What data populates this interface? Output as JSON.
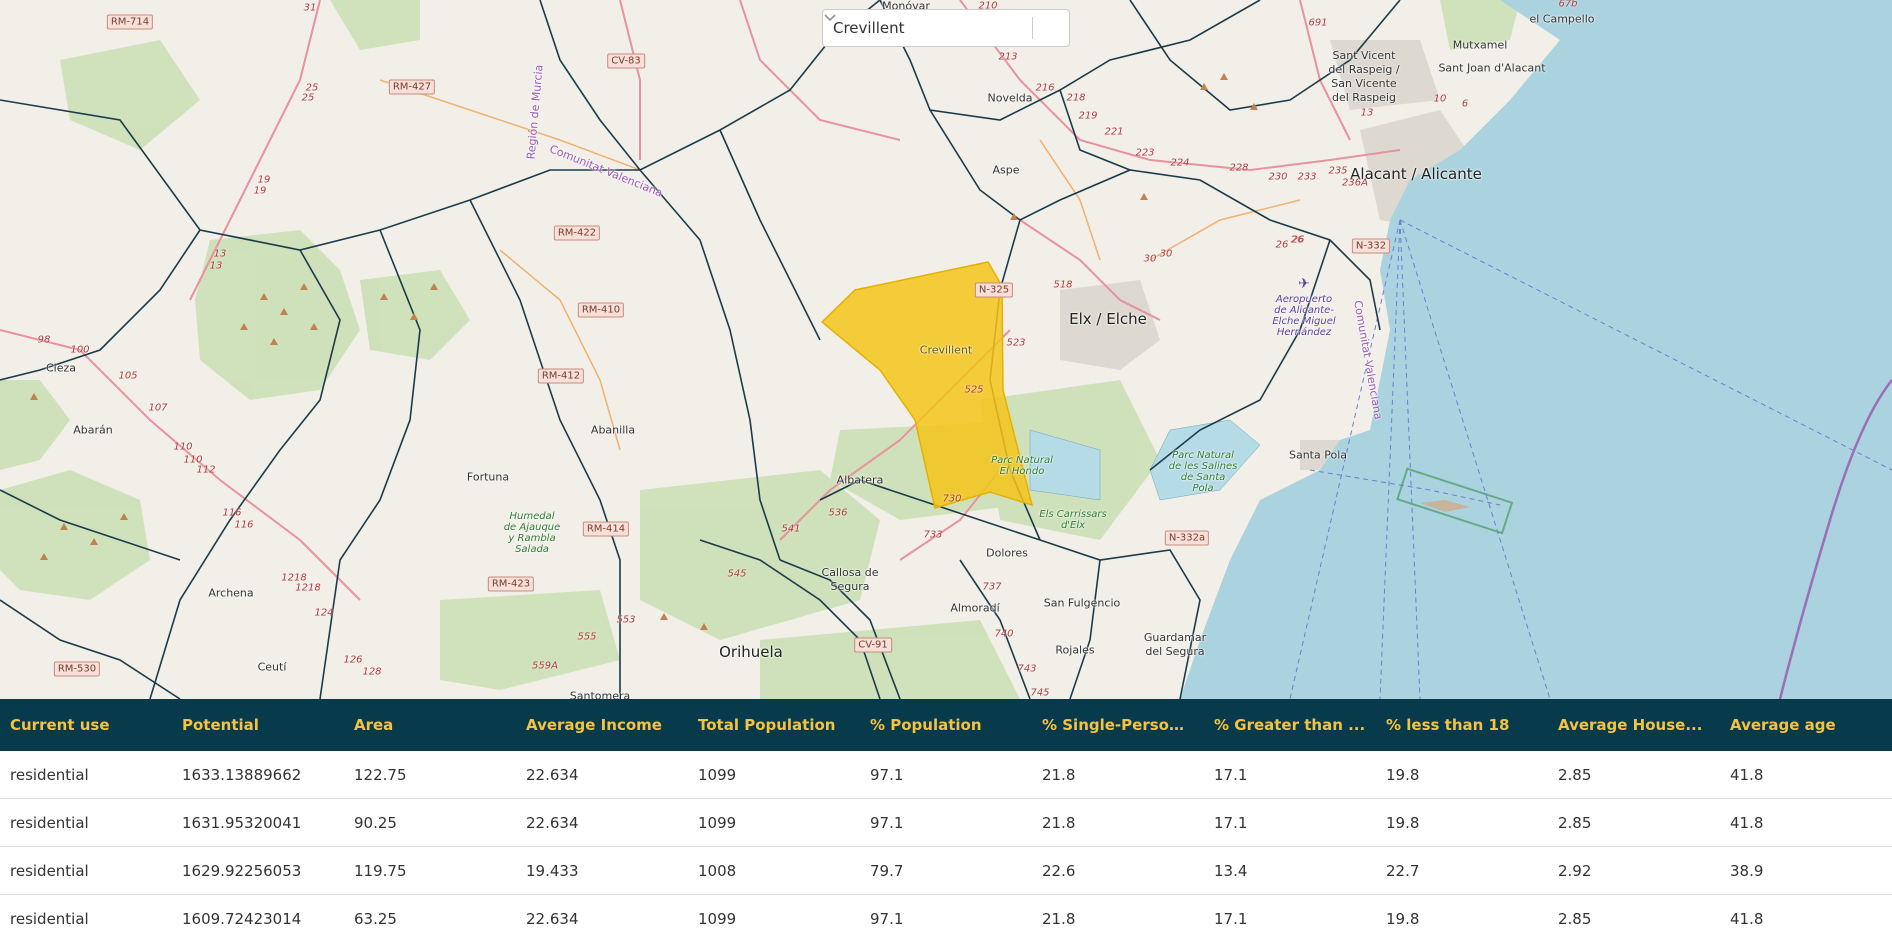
{
  "search": {
    "selected": "Crevillent"
  },
  "map": {
    "places": [
      {
        "label": "Monóvar",
        "cls": "small"
      },
      {
        "label": "Novelda",
        "cls": "small"
      },
      {
        "label": "Aspe",
        "cls": "small"
      },
      {
        "label": "Elx / Elche",
        "cls": "city"
      },
      {
        "label": "Crevillent",
        "cls": "small"
      },
      {
        "label": "Albatera",
        "cls": "small"
      },
      {
        "label": "Callosa de\nSegura",
        "cls": "small"
      },
      {
        "label": "Dolores",
        "cls": "small"
      },
      {
        "label": "Almoradí",
        "cls": "small"
      },
      {
        "label": "Orihuela",
        "cls": "city"
      },
      {
        "label": "San Fulgencio",
        "cls": "small"
      },
      {
        "label": "Rojales",
        "cls": "small"
      },
      {
        "label": "Guardamar\ndel Segura",
        "cls": "small"
      },
      {
        "label": "Santa Pola",
        "cls": "small"
      },
      {
        "label": "Alacant / Alicante",
        "cls": "city"
      },
      {
        "label": "Sant Vicent\ndel Raspeig /\nSan Vicente\ndel Raspeig",
        "cls": "small"
      },
      {
        "label": "Mutxamel",
        "cls": "small"
      },
      {
        "label": "Sant Joan d'Alacant",
        "cls": "small"
      },
      {
        "label": "el Campello",
        "cls": "small"
      },
      {
        "label": "Abanilla",
        "cls": "small"
      },
      {
        "label": "Fortuna",
        "cls": "small"
      },
      {
        "label": "Abarán",
        "cls": "small"
      },
      {
        "label": "Cieza",
        "cls": "small"
      },
      {
        "label": "Archena",
        "cls": "small"
      },
      {
        "label": "Ceutí",
        "cls": "small"
      },
      {
        "label": "Santomera",
        "cls": "small"
      },
      {
        "label": "Humedal\nde Ajauque\ny Rambla\nSalada",
        "cls": "park"
      },
      {
        "label": "Parc Natural\nde les Salines\nde Santa\nPola",
        "cls": "park"
      },
      {
        "label": "Els Carrissars\nd'Elx",
        "cls": "park"
      },
      {
        "label": "Parc Natural\nEl Hondo",
        "cls": "park"
      },
      {
        "label": "Aeropuerto\nde Alicante-\nElche Miguel\nHernández",
        "cls": "airport"
      },
      {
        "label": "Comunitat Valenciana",
        "cls": "border"
      },
      {
        "label": "Región de Murcia",
        "cls": "border"
      },
      {
        "label": "Comunitat Valenciana",
        "cls": "border"
      }
    ],
    "shields": [
      "RM-714",
      "CV-83",
      "RM-427",
      "RM-422",
      "RM-410",
      "RM-412",
      "RM-414",
      "RM-423",
      "RM-530",
      "CV-91",
      "N-325",
      "N-332",
      "N-332a"
    ],
    "road_numbers": [
      "31",
      "25",
      "25",
      "19",
      "19",
      "13",
      "13",
      "98",
      "100",
      "105",
      "107",
      "110",
      "110",
      "112",
      "116",
      "116",
      "1218",
      "1218",
      "124",
      "126",
      "128",
      "555",
      "553",
      "559A",
      "545",
      "541",
      "536",
      "733",
      "730",
      "737",
      "740",
      "743",
      "745",
      "210",
      "213",
      "216",
      "218",
      "219",
      "221",
      "223",
      "224",
      "228",
      "230",
      "233",
      "235",
      "236A",
      "26",
      "13",
      "10",
      "6",
      "67b",
      "691",
      "518",
      "523",
      "525",
      "30",
      "30",
      "26",
      "26"
    ]
  },
  "table": {
    "columns": [
      "Current use",
      "Potential",
      "Area",
      "Average Income",
      "Total Population",
      "% Population",
      "% Single-Person...",
      "% Greater than ...",
      "% less than 18",
      "Average House...",
      "Average age"
    ],
    "rows": [
      [
        "residential",
        "1633.13889662",
        "122.75",
        "22.634",
        "1099",
        "97.1",
        "21.8",
        "17.1",
        "19.8",
        "2.85",
        "41.8"
      ],
      [
        "residential",
        "1631.95320041",
        "90.25",
        "22.634",
        "1099",
        "97.1",
        "21.8",
        "17.1",
        "19.8",
        "2.85",
        "41.8"
      ],
      [
        "residential",
        "1629.92256053",
        "119.75",
        "19.433",
        "1008",
        "79.7",
        "22.6",
        "13.4",
        "22.7",
        "2.92",
        "38.9"
      ],
      [
        "residential",
        "1609.72423014",
        "63.25",
        "22.634",
        "1099",
        "97.1",
        "21.8",
        "17.1",
        "19.8",
        "2.85",
        "41.8"
      ]
    ]
  },
  "colors": {
    "selected_area": "#f5c41a",
    "header_bg": "#073a4b",
    "header_text": "#f5c242",
    "sea": "#aad3df"
  }
}
